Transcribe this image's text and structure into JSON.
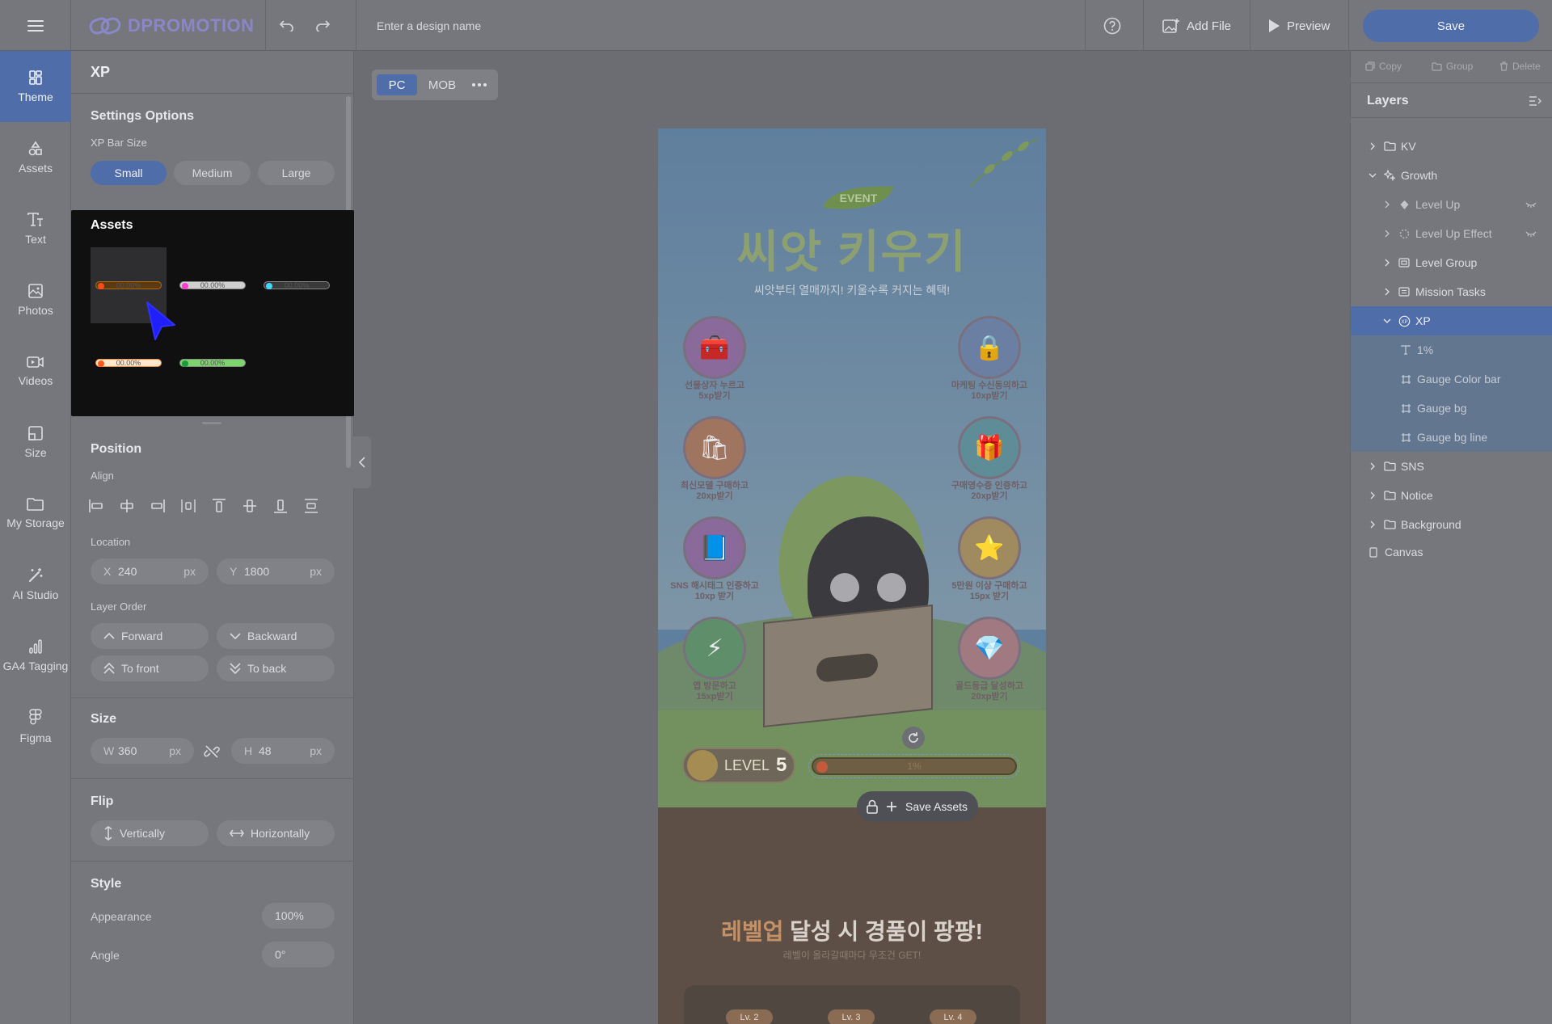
{
  "app": {
    "brand": "DPROMOTION",
    "design_name_placeholder": "Enter a design name",
    "add_file": "Add File",
    "preview": "Preview",
    "save": "Save"
  },
  "rail": [
    {
      "label": "Theme",
      "icon": "theme-icon",
      "active": true
    },
    {
      "label": "Assets",
      "icon": "shapes-icon"
    },
    {
      "label": "Text",
      "icon": "text-icon"
    },
    {
      "label": "Photos",
      "icon": "image-icon"
    },
    {
      "label": "Videos",
      "icon": "video-icon"
    },
    {
      "label": "Size",
      "icon": "resize-icon"
    },
    {
      "label": "My Storage",
      "icon": "folder-icon"
    },
    {
      "label": "AI Studio",
      "icon": "magic-wand-icon"
    },
    {
      "label": "GA4 Tagging",
      "icon": "analytics-icon"
    },
    {
      "label": "Figma",
      "icon": "figma-icon"
    }
  ],
  "panel": {
    "title": "XP",
    "settings": {
      "title": "Settings Options",
      "size_label": "XP Bar Size",
      "sizes": [
        "Small",
        "Medium",
        "Large"
      ],
      "selected": "Small"
    },
    "assets": {
      "title": "Assets",
      "bar_text": "00.00%",
      "items": [
        {
          "track": "#5a3a12",
          "dot": "#ff4a1a"
        },
        {
          "track": "#cfcfcf",
          "dot": "#ff3bd4"
        },
        {
          "track": "#3a3a3a",
          "dot": "#3fd8ff"
        },
        {
          "track": "#ffe8d0",
          "dot": "#ff5a1a"
        },
        {
          "track": "#7cd46a",
          "dot": "#1a9a3a"
        }
      ]
    },
    "position": {
      "title": "Position",
      "align_label": "Align",
      "location_label": "Location",
      "x": "240",
      "y": "1800",
      "unit": "px",
      "layer_order_label": "Layer Order",
      "forward": "Forward",
      "backward": "Backward",
      "to_front": "To front",
      "to_back": "To back"
    },
    "size": {
      "title": "Size",
      "w": "360",
      "h": "48",
      "unit": "px"
    },
    "flip": {
      "title": "Flip",
      "vertical": "Vertically",
      "horizontal": "Horizontally"
    },
    "style": {
      "title": "Style",
      "appearance_label": "Appearance",
      "appearance": "100%",
      "angle_label": "Angle",
      "angle": "0°"
    }
  },
  "view": {
    "pc": "PC",
    "mob": "MOB"
  },
  "artboard": {
    "event": "EVENT",
    "title": "씨앗 키우기",
    "subtitle": "씨앗부터 열매까지! 키울수록 커지는 혜택!",
    "missions": [
      {
        "line1": "선물상자 누르고",
        "line2": "5xp받기",
        "emoji": "🧰",
        "bg": "#8a6a9a"
      },
      {
        "line1": "마케팅 수신동의하고",
        "line2": "10xp받기",
        "emoji": "🔒",
        "bg": "#6b7fa3"
      },
      {
        "line1": "최신모델 구매하고",
        "line2": "20xp받기",
        "emoji": "🛍",
        "bg": "#a0755f"
      },
      {
        "line1": "구매영수증 인증하고",
        "line2": "20xp받기",
        "emoji": "🎁",
        "bg": "#5f8d97"
      },
      {
        "line1": "SNS 해시태그 인증하고",
        "line2": "10xp 받기",
        "emoji": "📘",
        "bg": "#8a6a9a"
      },
      {
        "line1": "5만원 이상 구매하고",
        "line2": "15px 받기",
        "emoji": "⭐",
        "bg": "#a08a5f"
      },
      {
        "line1": "앱 방문하고",
        "line2": "15xp받기",
        "emoji": "⚡",
        "bg": "#5f8f6a"
      },
      {
        "line1": "골드등급 달성하고",
        "line2": "20xp받기",
        "emoji": "💎",
        "bg": "#a07a80"
      }
    ],
    "level_text": "LEVEL",
    "level_num": "5",
    "xp_percent": "1%",
    "save_assets": "Save Assets",
    "levelup_highlight": "레벨업",
    "levelup_rest": " 달성 시 경품이 팡팡!",
    "levelup_sub": "레벨이 올라갈때마다 무조건 GET!",
    "chips": [
      "Lv. 2",
      "Lv. 3",
      "Lv. 4"
    ]
  },
  "right": {
    "copy": "Copy",
    "group": "Group",
    "delete": "Delete",
    "layers_title": "Layers",
    "layers": [
      {
        "name": "KV",
        "kind": "folder",
        "level": 0,
        "chev": "right"
      },
      {
        "name": "Growth",
        "kind": "sparkle",
        "level": 0,
        "chev": "down"
      },
      {
        "name": "Level Up",
        "kind": "diamond",
        "level": 1,
        "chev": "right",
        "dim": true,
        "eye": true
      },
      {
        "name": "Level Up Effect",
        "kind": "dotted",
        "level": 1,
        "chev": "right",
        "dim": true,
        "eye": true
      },
      {
        "name": "Level Group",
        "kind": "component",
        "level": 1,
        "chev": "right"
      },
      {
        "name": "Mission Tasks",
        "kind": "list",
        "level": 1,
        "chev": "right"
      },
      {
        "name": "XP",
        "kind": "xp",
        "level": 1,
        "chev": "down",
        "selected": true
      },
      {
        "name": "1%",
        "kind": "text",
        "level": 2,
        "child": true
      },
      {
        "name": "Gauge Color bar",
        "kind": "frame",
        "level": 2,
        "child": true
      },
      {
        "name": "Gauge bg",
        "kind": "frame",
        "level": 2,
        "child": true
      },
      {
        "name": "Gauge bg line",
        "kind": "frame",
        "level": 2,
        "child": true
      },
      {
        "name": "SNS",
        "kind": "folder",
        "level": 0,
        "chev": "right"
      },
      {
        "name": "Notice",
        "kind": "folder",
        "level": 0,
        "chev": "right"
      },
      {
        "name": "Background",
        "kind": "folder",
        "level": 0,
        "chev": "right"
      },
      {
        "name": "Canvas",
        "kind": "canvas",
        "level": 0
      }
    ]
  }
}
